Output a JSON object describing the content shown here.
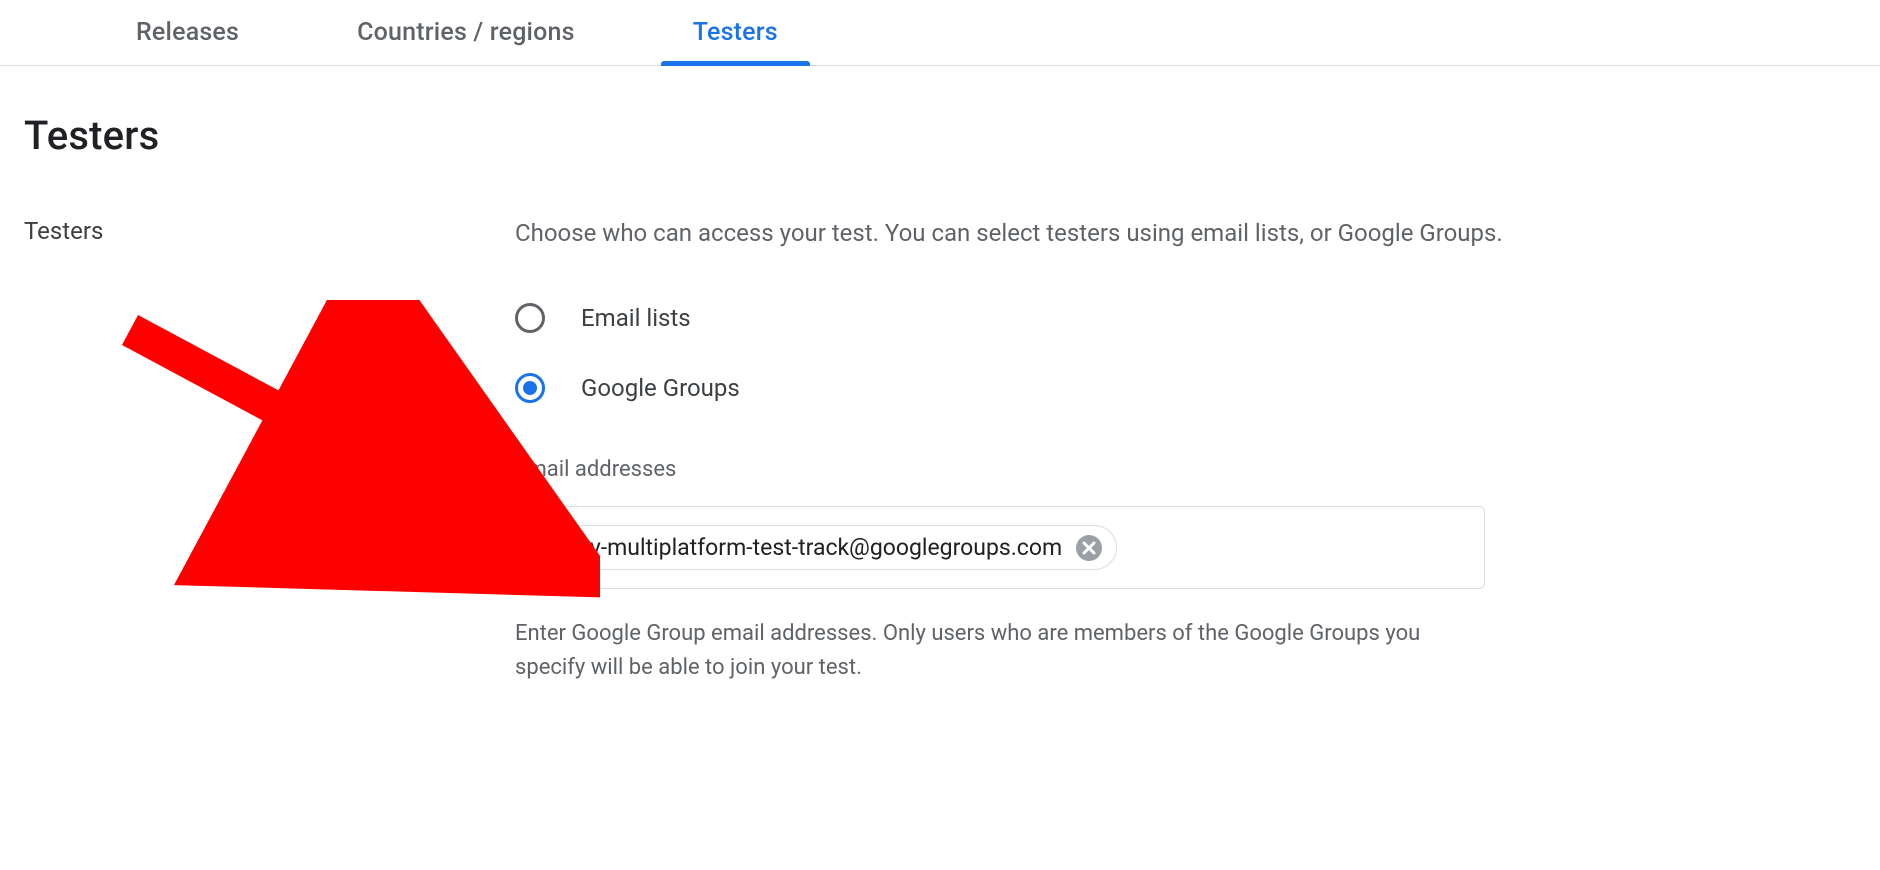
{
  "tabs": {
    "releases": "Releases",
    "countries": "Countries / regions",
    "testers": "Testers"
  },
  "heading": "Testers",
  "sideLabel": "Testers",
  "intro": "Choose who can access your test. You can select testers using email lists, or Google Groups.",
  "radios": {
    "emailLists": "Email lists",
    "googleGroups": "Google Groups"
  },
  "emailField": {
    "label": "Email addresses",
    "chip": "play-multiplatform-test-track@googlegroups.com",
    "help": "Enter Google Group email addresses. Only users who are members of the Google Groups you specify will be able to join your test."
  },
  "annotation": {
    "color": "#ff0000"
  }
}
